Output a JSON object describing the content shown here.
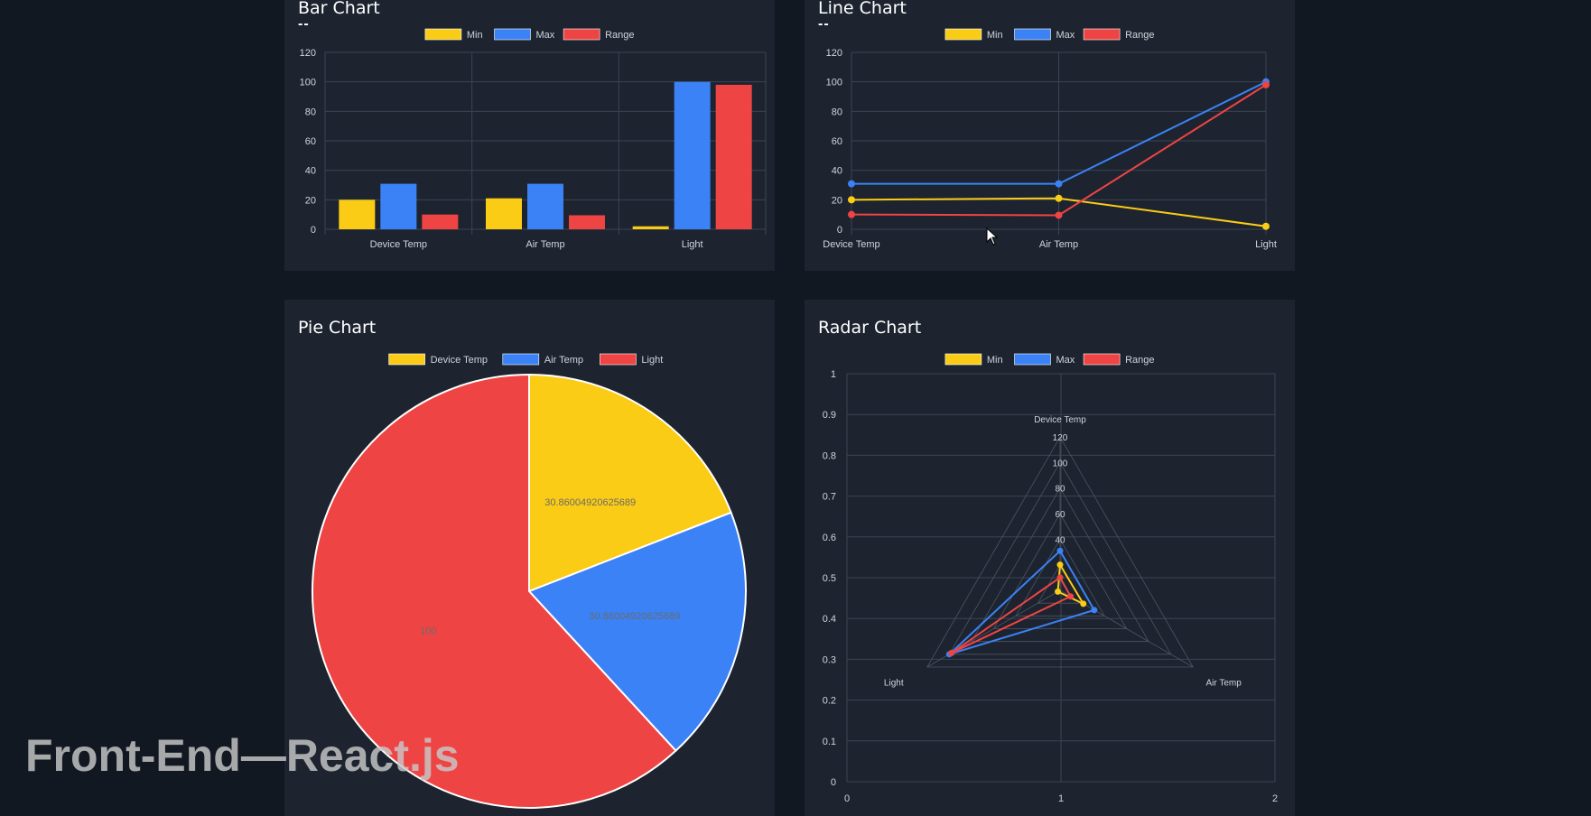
{
  "colors": {
    "min": "#facc15",
    "max": "#3b82f6",
    "range": "#ef4444"
  },
  "bar": {
    "title": "Bar Chart",
    "subtitle": "--",
    "legend": [
      "Min",
      "Max",
      "Range"
    ],
    "yticks": [
      "0",
      "20",
      "40",
      "60",
      "80",
      "100",
      "120"
    ]
  },
  "line": {
    "title": "Line Chart",
    "subtitle": "--",
    "legend": [
      "Min",
      "Max",
      "Range"
    ],
    "yticks": [
      "0",
      "20",
      "40",
      "60",
      "80",
      "100",
      "120"
    ]
  },
  "pie": {
    "title": "Pie Chart",
    "legend": [
      "Device Temp",
      "Air Temp",
      "Light"
    ],
    "labels": [
      "30.86004920625689",
      "30.86004920625689",
      "100"
    ]
  },
  "radar": {
    "title": "Radar Chart",
    "legend": [
      "Min",
      "Max",
      "Range"
    ],
    "axis_labels": [
      "Device Temp",
      "Air Temp",
      "Light"
    ],
    "rticks": [
      "40",
      "60",
      "80",
      "100",
      "120"
    ],
    "yticks": [
      "0",
      "0.1",
      "0.2",
      "0.3",
      "0.4",
      "0.5",
      "0.6",
      "0.7",
      "0.8",
      "0.9",
      "1"
    ],
    "xticks": [
      "0",
      "1",
      "2"
    ]
  },
  "watermark": "Front-End—React.js",
  "chart_data": [
    {
      "type": "bar",
      "title": "Bar Chart",
      "categories": [
        "Device Temp",
        "Air Temp",
        "Light"
      ],
      "series": [
        {
          "name": "Min",
          "values": [
            20,
            21,
            2
          ]
        },
        {
          "name": "Max",
          "values": [
            30.86,
            30.86,
            100
          ]
        },
        {
          "name": "Range",
          "values": [
            10,
            9.5,
            98
          ]
        }
      ],
      "ylim": [
        0,
        120
      ],
      "legend": "top"
    },
    {
      "type": "line",
      "title": "Line Chart",
      "categories": [
        "Device Temp",
        "Air Temp",
        "Light"
      ],
      "series": [
        {
          "name": "Min",
          "values": [
            20,
            21,
            2
          ]
        },
        {
          "name": "Max",
          "values": [
            30.86,
            30.86,
            100
          ]
        },
        {
          "name": "Range",
          "values": [
            10,
            9.5,
            98
          ]
        }
      ],
      "ylim": [
        0,
        120
      ],
      "legend": "top"
    },
    {
      "type": "pie",
      "title": "Pie Chart",
      "categories": [
        "Device Temp",
        "Air Temp",
        "Light"
      ],
      "values": [
        30.86004920625689,
        30.86004920625689,
        100
      ],
      "legend": "top"
    },
    {
      "type": "radar",
      "title": "Radar Chart",
      "categories": [
        "Device Temp",
        "Air Temp",
        "Light"
      ],
      "series": [
        {
          "name": "Min",
          "values": [
            20,
            21,
            2
          ]
        },
        {
          "name": "Max",
          "values": [
            30.86,
            30.86,
            100
          ]
        },
        {
          "name": "Range",
          "values": [
            10,
            9.5,
            98
          ]
        }
      ],
      "rlim": [
        0,
        120
      ],
      "legend": "top"
    }
  ]
}
